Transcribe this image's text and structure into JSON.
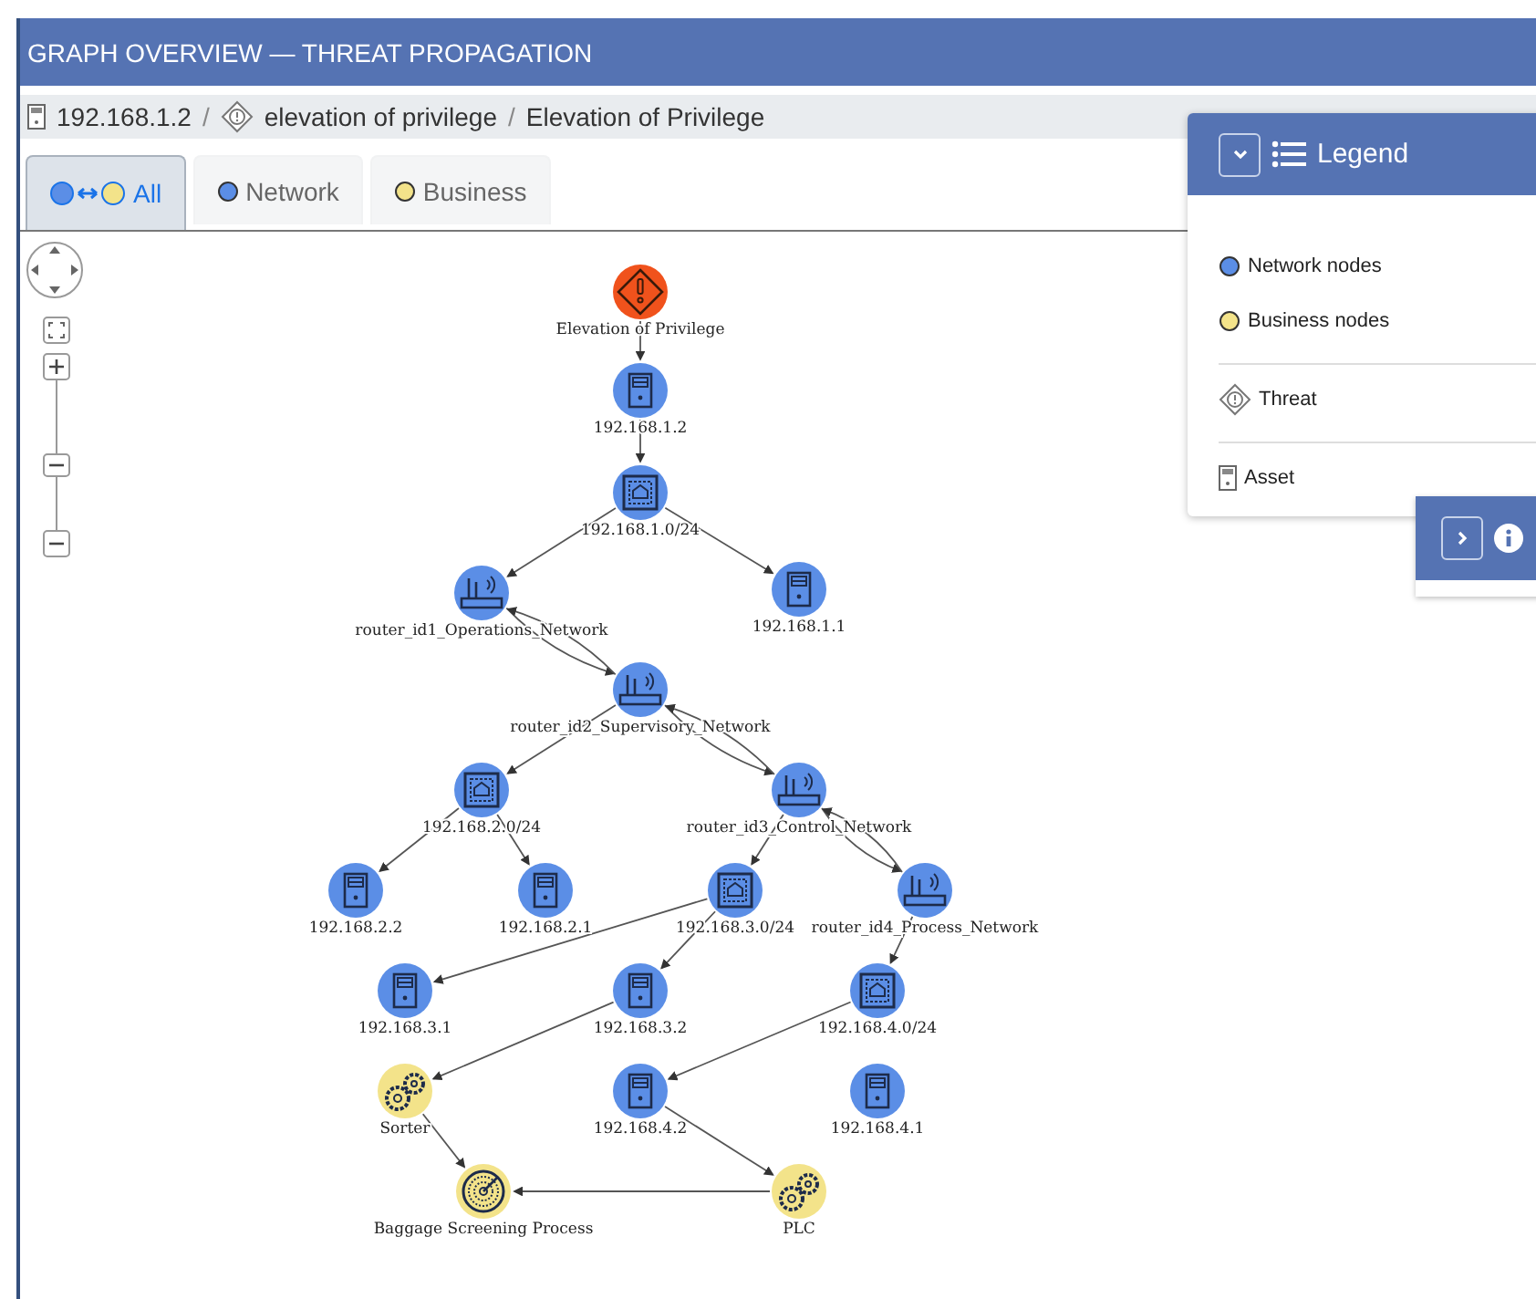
{
  "header": {
    "title": "GRAPH OVERVIEW — THREAT PROPAGATION"
  },
  "breadcrumb": {
    "separator": "/",
    "items": [
      {
        "kind": "asset",
        "label": "192.168.1.2"
      },
      {
        "kind": "threat",
        "label": "elevation of privilege"
      },
      {
        "kind": "plain",
        "label": "Elevation of Privilege"
      }
    ]
  },
  "tabs": [
    {
      "kind": "both",
      "label": "All",
      "selected": true
    },
    {
      "kind": "network",
      "label": "Network",
      "selected": false
    },
    {
      "kind": "business",
      "label": "Business",
      "selected": false
    }
  ],
  "legend": {
    "title": "Legend",
    "expanded": true,
    "items": [
      {
        "kind": "dot",
        "label": "Network nodes",
        "color": "#5b8ee6"
      },
      {
        "kind": "dot",
        "label": "Business nodes",
        "color": "#f3e38a"
      },
      {
        "kind": "threat",
        "label": "Threat"
      },
      {
        "kind": "asset",
        "label": "Asset"
      }
    ]
  },
  "graph": {
    "nodes": [
      {
        "kind": "threat",
        "color": "#f0521c",
        "label": "Elevation of Privilege"
      },
      {
        "kind": "server",
        "color": "#5b8ee6",
        "label": "192.168.1.2"
      },
      {
        "kind": "subnet",
        "color": "#5b8ee6",
        "label": "192.168.1.0/24"
      },
      {
        "kind": "router",
        "color": "#5b8ee6",
        "label": "router_id1_Operations_Network"
      },
      {
        "kind": "server",
        "color": "#5b8ee6",
        "label": "192.168.1.1"
      },
      {
        "kind": "router",
        "color": "#5b8ee6",
        "label": "router_id2_Supervisory_Network"
      },
      {
        "kind": "subnet",
        "color": "#5b8ee6",
        "label": "192.168.2.0/24"
      },
      {
        "kind": "router",
        "color": "#5b8ee6",
        "label": "router_id3_Control_Network"
      },
      {
        "kind": "server",
        "color": "#5b8ee6",
        "label": "192.168.2.2"
      },
      {
        "kind": "server",
        "color": "#5b8ee6",
        "label": "192.168.2.1"
      },
      {
        "kind": "subnet",
        "color": "#5b8ee6",
        "label": "192.168.3.0/24"
      },
      {
        "kind": "router",
        "color": "#5b8ee6",
        "label": "router_id4_Process_Network"
      },
      {
        "kind": "server",
        "color": "#5b8ee6",
        "label": "192.168.3.1"
      },
      {
        "kind": "server",
        "color": "#5b8ee6",
        "label": "192.168.3.2"
      },
      {
        "kind": "subnet",
        "color": "#5b8ee6",
        "label": "192.168.4.0/24"
      },
      {
        "kind": "gears",
        "color": "#f3e38a",
        "label": "Sorter"
      },
      {
        "kind": "server",
        "color": "#5b8ee6",
        "label": "192.168.4.2"
      },
      {
        "kind": "server",
        "color": "#5b8ee6",
        "label": "192.168.4.1"
      },
      {
        "kind": "radar",
        "color": "#f3e38a",
        "label": "Baggage Screening Process"
      },
      {
        "kind": "gears",
        "color": "#f3e38a",
        "label": "PLC"
      }
    ]
  }
}
